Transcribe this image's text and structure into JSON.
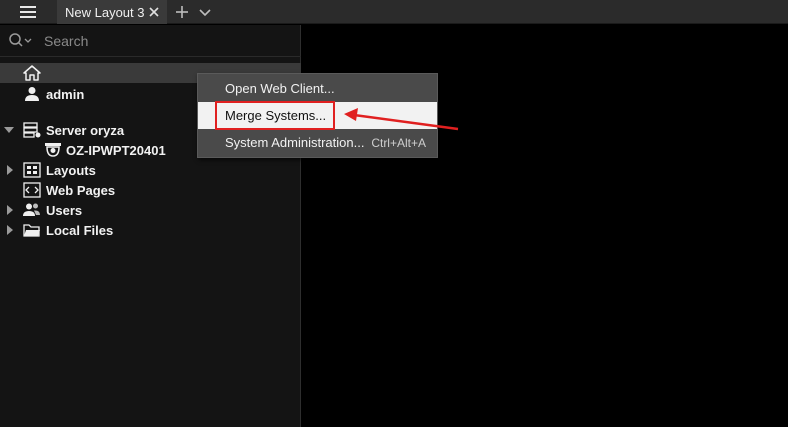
{
  "tabs": [
    {
      "label": "New Layout 3"
    }
  ],
  "search": {
    "placeholder": "Search"
  },
  "tree": {
    "home_label": "",
    "user": {
      "label": "admin"
    },
    "server": {
      "label": "Server oryza"
    },
    "camera": {
      "label": "OZ-IPWPT20401"
    },
    "layouts": {
      "label": "Layouts"
    },
    "web_pages": {
      "label": "Web Pages"
    },
    "users": {
      "label": "Users"
    },
    "local_files": {
      "label": "Local Files"
    }
  },
  "context_menu": {
    "items": [
      {
        "label": "Open Web Client...",
        "shortcut": ""
      },
      {
        "label": "Merge Systems...",
        "shortcut": ""
      },
      {
        "label": "System Administration...",
        "shortcut": "Ctrl+Alt+A"
      }
    ]
  },
  "colors": {
    "annotation_red": "#e02020",
    "panel_bg": "#141414",
    "menu_bg": "#4a4a4a"
  },
  "icons": [
    "hamburger-icon",
    "close-icon",
    "plus-icon",
    "chevron-down-icon",
    "search-icon",
    "home-icon",
    "user-icon",
    "server-icon",
    "camera-icon",
    "layouts-icon",
    "web-page-icon",
    "users-icon",
    "folder-icon"
  ]
}
